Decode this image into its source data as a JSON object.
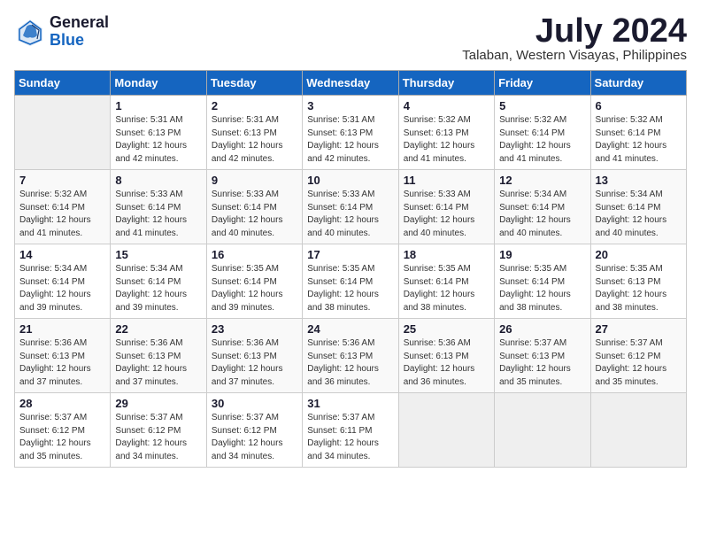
{
  "logo": {
    "line1": "General",
    "line2": "Blue"
  },
  "title": "July 2024",
  "location": "Talaban, Western Visayas, Philippines",
  "days_of_week": [
    "Sunday",
    "Monday",
    "Tuesday",
    "Wednesday",
    "Thursday",
    "Friday",
    "Saturday"
  ],
  "weeks": [
    [
      {
        "num": "",
        "info": ""
      },
      {
        "num": "1",
        "info": "Sunrise: 5:31 AM\nSunset: 6:13 PM\nDaylight: 12 hours\nand 42 minutes."
      },
      {
        "num": "2",
        "info": "Sunrise: 5:31 AM\nSunset: 6:13 PM\nDaylight: 12 hours\nand 42 minutes."
      },
      {
        "num": "3",
        "info": "Sunrise: 5:31 AM\nSunset: 6:13 PM\nDaylight: 12 hours\nand 42 minutes."
      },
      {
        "num": "4",
        "info": "Sunrise: 5:32 AM\nSunset: 6:13 PM\nDaylight: 12 hours\nand 41 minutes."
      },
      {
        "num": "5",
        "info": "Sunrise: 5:32 AM\nSunset: 6:14 PM\nDaylight: 12 hours\nand 41 minutes."
      },
      {
        "num": "6",
        "info": "Sunrise: 5:32 AM\nSunset: 6:14 PM\nDaylight: 12 hours\nand 41 minutes."
      }
    ],
    [
      {
        "num": "7",
        "info": "Sunrise: 5:32 AM\nSunset: 6:14 PM\nDaylight: 12 hours\nand 41 minutes."
      },
      {
        "num": "8",
        "info": "Sunrise: 5:33 AM\nSunset: 6:14 PM\nDaylight: 12 hours\nand 41 minutes."
      },
      {
        "num": "9",
        "info": "Sunrise: 5:33 AM\nSunset: 6:14 PM\nDaylight: 12 hours\nand 40 minutes."
      },
      {
        "num": "10",
        "info": "Sunrise: 5:33 AM\nSunset: 6:14 PM\nDaylight: 12 hours\nand 40 minutes."
      },
      {
        "num": "11",
        "info": "Sunrise: 5:33 AM\nSunset: 6:14 PM\nDaylight: 12 hours\nand 40 minutes."
      },
      {
        "num": "12",
        "info": "Sunrise: 5:34 AM\nSunset: 6:14 PM\nDaylight: 12 hours\nand 40 minutes."
      },
      {
        "num": "13",
        "info": "Sunrise: 5:34 AM\nSunset: 6:14 PM\nDaylight: 12 hours\nand 40 minutes."
      }
    ],
    [
      {
        "num": "14",
        "info": "Sunrise: 5:34 AM\nSunset: 6:14 PM\nDaylight: 12 hours\nand 39 minutes."
      },
      {
        "num": "15",
        "info": "Sunrise: 5:34 AM\nSunset: 6:14 PM\nDaylight: 12 hours\nand 39 minutes."
      },
      {
        "num": "16",
        "info": "Sunrise: 5:35 AM\nSunset: 6:14 PM\nDaylight: 12 hours\nand 39 minutes."
      },
      {
        "num": "17",
        "info": "Sunrise: 5:35 AM\nSunset: 6:14 PM\nDaylight: 12 hours\nand 38 minutes."
      },
      {
        "num": "18",
        "info": "Sunrise: 5:35 AM\nSunset: 6:14 PM\nDaylight: 12 hours\nand 38 minutes."
      },
      {
        "num": "19",
        "info": "Sunrise: 5:35 AM\nSunset: 6:14 PM\nDaylight: 12 hours\nand 38 minutes."
      },
      {
        "num": "20",
        "info": "Sunrise: 5:35 AM\nSunset: 6:13 PM\nDaylight: 12 hours\nand 38 minutes."
      }
    ],
    [
      {
        "num": "21",
        "info": "Sunrise: 5:36 AM\nSunset: 6:13 PM\nDaylight: 12 hours\nand 37 minutes."
      },
      {
        "num": "22",
        "info": "Sunrise: 5:36 AM\nSunset: 6:13 PM\nDaylight: 12 hours\nand 37 minutes."
      },
      {
        "num": "23",
        "info": "Sunrise: 5:36 AM\nSunset: 6:13 PM\nDaylight: 12 hours\nand 37 minutes."
      },
      {
        "num": "24",
        "info": "Sunrise: 5:36 AM\nSunset: 6:13 PM\nDaylight: 12 hours\nand 36 minutes."
      },
      {
        "num": "25",
        "info": "Sunrise: 5:36 AM\nSunset: 6:13 PM\nDaylight: 12 hours\nand 36 minutes."
      },
      {
        "num": "26",
        "info": "Sunrise: 5:37 AM\nSunset: 6:13 PM\nDaylight: 12 hours\nand 35 minutes."
      },
      {
        "num": "27",
        "info": "Sunrise: 5:37 AM\nSunset: 6:12 PM\nDaylight: 12 hours\nand 35 minutes."
      }
    ],
    [
      {
        "num": "28",
        "info": "Sunrise: 5:37 AM\nSunset: 6:12 PM\nDaylight: 12 hours\nand 35 minutes."
      },
      {
        "num": "29",
        "info": "Sunrise: 5:37 AM\nSunset: 6:12 PM\nDaylight: 12 hours\nand 34 minutes."
      },
      {
        "num": "30",
        "info": "Sunrise: 5:37 AM\nSunset: 6:12 PM\nDaylight: 12 hours\nand 34 minutes."
      },
      {
        "num": "31",
        "info": "Sunrise: 5:37 AM\nSunset: 6:11 PM\nDaylight: 12 hours\nand 34 minutes."
      },
      {
        "num": "",
        "info": ""
      },
      {
        "num": "",
        "info": ""
      },
      {
        "num": "",
        "info": ""
      }
    ]
  ]
}
